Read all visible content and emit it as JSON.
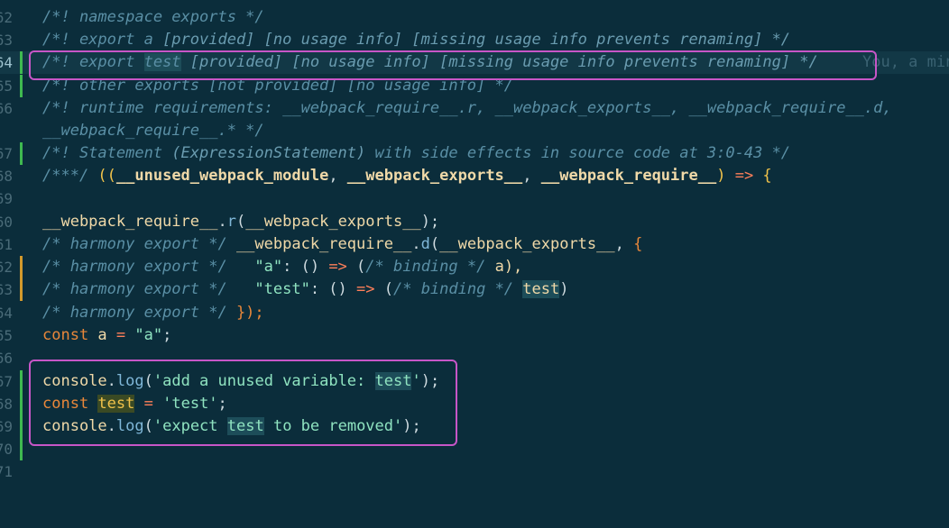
{
  "line_numbers": [
    "62",
    "63",
    "64",
    "65",
    "66",
    "",
    "67",
    "68",
    "69",
    "60",
    "61",
    "62",
    "63",
    "64",
    "65",
    "66",
    "67",
    "68",
    "69",
    "70",
    "71"
  ],
  "lines": {
    "l1": "/*! namespace exports */",
    "l2a": "/*! export a ",
    "l2b": "[provided] [no usage info] [missing usage info prevents renaming] */",
    "l3a": "/*! export ",
    "l3b": "test",
    "l3c": " [provided] [no usage info] [missing usage info prevents renaming] */",
    "l3ghost": "You, a min",
    "l4": "/*! other exports [not provided] [no usage info] */",
    "l5": "/*! runtime requirements: __webpack_require__.r, __webpack_exports__, __webpack_require__.d,",
    "l6": "__webpack_require__.* */",
    "l7a": "/*! Statement ",
    "l7b": "(ExpressionStatement)",
    "l7c": " with side effects in source code at 3:0-43 */",
    "l8a": "/***/ ",
    "l8b": "((",
    "l8c": "__unused_webpack_module",
    "l8d": ", ",
    "l8e": "__webpack_exports__",
    "l8f": ", ",
    "l8g": "__webpack_require__",
    "l8h": ") ",
    "l8i": "=>",
    "l8j": " {",
    "l10a": "__webpack_require__",
    "l10b": ".",
    "l10c": "r",
    "l10d": "(",
    "l10e": "__webpack_exports__",
    "l10f": ");",
    "l11a": "/* harmony export */ ",
    "l11b": "__webpack_require__",
    "l11c": ".",
    "l11d": "d",
    "l11e": "(",
    "l11f": "__webpack_exports__",
    "l11g": ", ",
    "l11h": "{",
    "l12a": "/* harmony export */   ",
    "l12b": "\"a\"",
    "l12c": ": () ",
    "l12d": "=>",
    "l12e": " (",
    "l12f": "/* binding */",
    "l12g": " a),",
    "l13a": "/* harmony export */   ",
    "l13b": "\"test\"",
    "l13c": ": () ",
    "l13d": "=>",
    "l13e": " (",
    "l13f": "/* binding */",
    "l13g": " ",
    "l13h": "test",
    "l13i": ")",
    "l14a": "/* harmony export */ ",
    "l14b": "});",
    "l15a": "const",
    "l15b": " a ",
    "l15c": "=",
    "l15d": " \"a\"",
    "l15e": ";",
    "l17a": "console",
    "l17b": ".",
    "l17c": "log",
    "l17d": "(",
    "l17e": "'add a unused variable: ",
    "l17f": "test",
    "l17g": "'",
    "l17h": ");",
    "l18a": "const",
    "l18b": " ",
    "l18c": "test",
    "l18d": " ",
    "l18e": "=",
    "l18f": " 'test'",
    "l18g": ";",
    "l19a": "console",
    "l19b": ".",
    "l19c": "log",
    "l19d": "(",
    "l19e": "'expect ",
    "l19f": "test",
    "l19g": " to be removed'",
    "l19h": ");"
  },
  "colors": {
    "background": "#0b2d3b",
    "highlight_box": "#c756c7",
    "git_added": "#3fb950",
    "git_modified": "#d39a2c"
  }
}
